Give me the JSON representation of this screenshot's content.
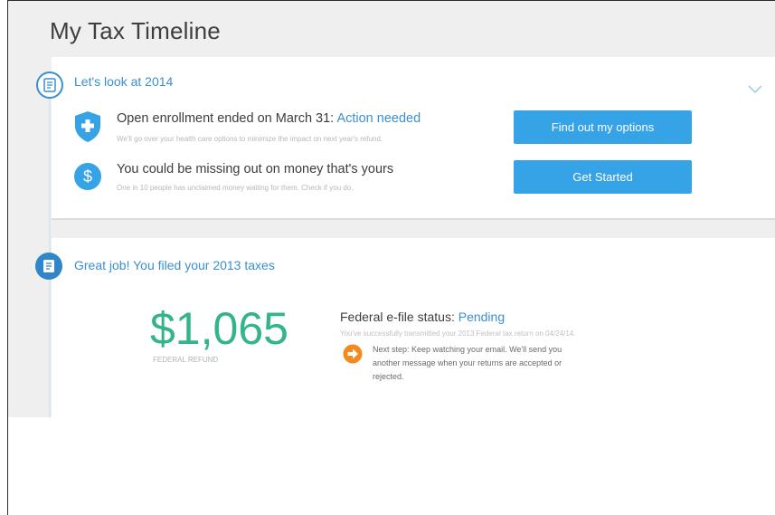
{
  "app": {
    "title": "My Tax Timeline"
  },
  "colors": {
    "accent": "#35a3e6",
    "link": "#3a8fd0",
    "refund": "#34b489",
    "alert_orange": "#f28a1e"
  },
  "section_2014": {
    "title": "Let's look at 2014",
    "icon": "document-icon",
    "items": [
      {
        "icon": "shield-plus-icon",
        "title_prefix": "Open enrollment ended on March 31: ",
        "title_link": "Action needed",
        "subtitle": "We'll go over your health care options to minimize the impact on next year's refund.",
        "button_label": "Find out my options"
      },
      {
        "icon": "dollar-icon",
        "title": "You could be missing out on money that's yours",
        "subtitle": "One in 10 people has unclaimed money waiting for them. Check if you do.",
        "button_label": "Get Started"
      }
    ]
  },
  "section_2013": {
    "title": "Great job! You filed your 2013 taxes",
    "icon": "document-icon",
    "refund_amount": "$1,065",
    "refund_label": "FEDERAL REFUND",
    "efile_label": "Federal e-file status: ",
    "efile_status": "Pending",
    "efile_subtitle": "You've successfully transmitted your 2013 Federal tax return on 04/24/14.",
    "next_step": "Next step: Keep watching your email. We'll send you another message when your returns are accepted or rejected."
  }
}
